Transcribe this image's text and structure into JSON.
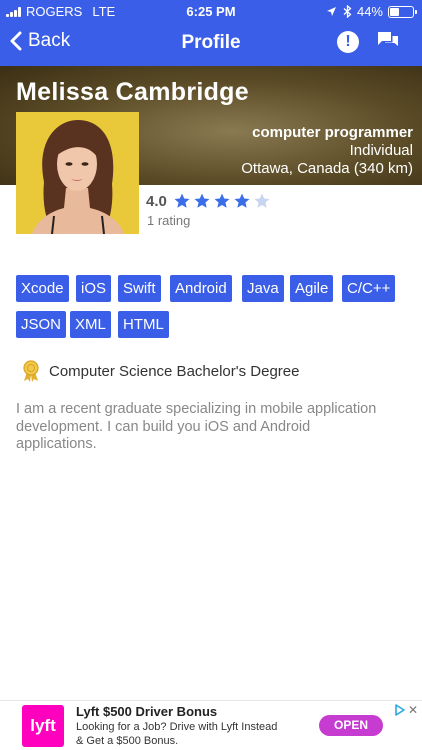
{
  "status_bar": {
    "carrier": "ROGERS",
    "network": "LTE",
    "time": "6:25 PM",
    "battery_text": "44%",
    "battery_level": 0.44,
    "icons": [
      "signal-icon",
      "location-arrow-icon",
      "bluetooth-icon",
      "battery-icon"
    ]
  },
  "nav": {
    "back_label": "Back",
    "title": "Profile",
    "icons": [
      "chevron-left-icon",
      "alert-icon",
      "chat-icon"
    ]
  },
  "profile": {
    "name": "Melissa Cambridge",
    "occupation": "computer programmer",
    "type": "Individual",
    "location": "Ottawa, Canada (340 km)",
    "rating_value": "4.0",
    "rating_stars": 4,
    "rating_max": 5,
    "rating_count": "1 rating"
  },
  "skills": [
    "Xcode",
    "iOS",
    "Swift",
    "Android",
    "Java",
    "Agile",
    "C/C++",
    "JSON",
    "XML",
    "HTML"
  ],
  "degree": {
    "label": "Computer Science Bachelor's Degree",
    "icon": "award-ribbon-icon"
  },
  "bio": "I am a recent graduate specializing in mobile application development. I can build you iOS and Android applications.",
  "ad": {
    "logo_text": "lyft",
    "title": "Lyft $500 Driver Bonus",
    "description": "Looking for a Job? Drive with Lyft Instead & Get a $500 Bonus.",
    "cta": "OPEN",
    "close_symbol": "✕"
  },
  "colors": {
    "primary": "#3a5ee8",
    "star": "#3a6de8",
    "star_empty": "#c9d4f2",
    "ad_logo": "#ff00bf",
    "ad_cta": "#c63bd0"
  }
}
